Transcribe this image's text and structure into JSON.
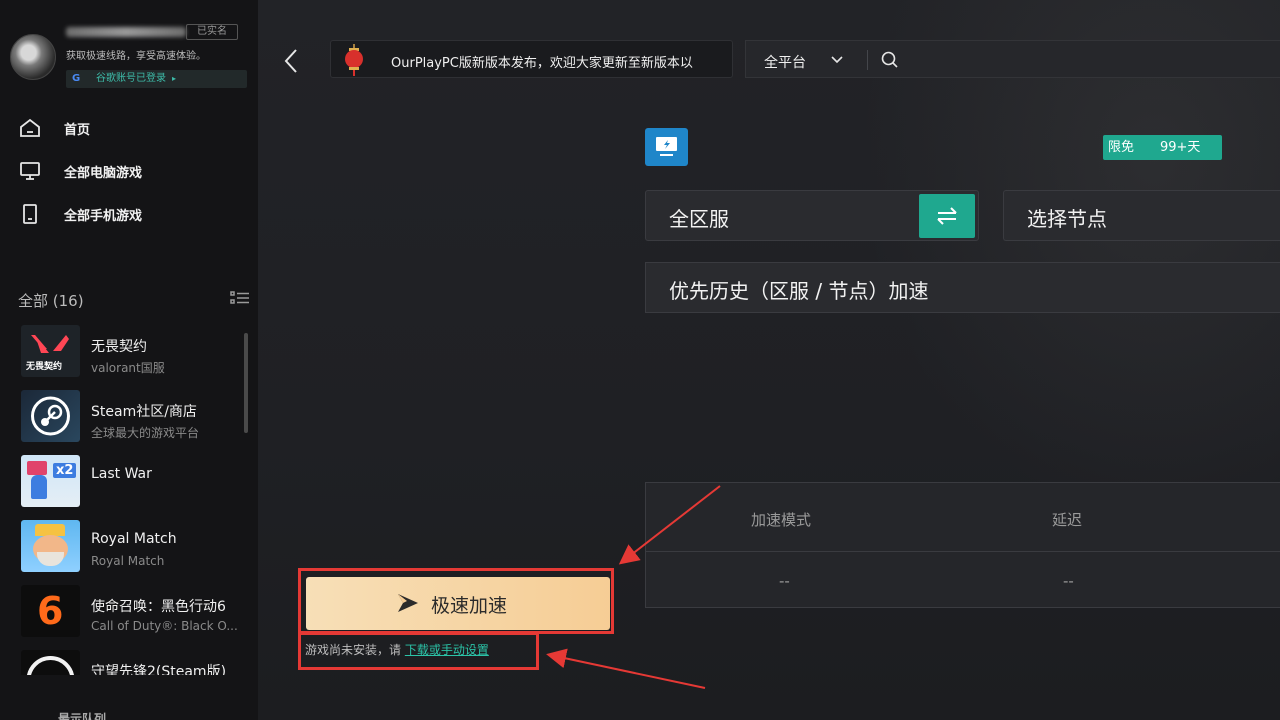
{
  "sidebar": {
    "realname_badge": "已实名",
    "slogan": "获取极速线路，享受高速体验。",
    "google_label": "谷歌账号已登录",
    "google_arrow": "▸",
    "nav": [
      {
        "label": "首页",
        "icon": "home-icon"
      },
      {
        "label": "全部电脑游戏",
        "icon": "desktop-icon"
      },
      {
        "label": "全部手机游戏",
        "icon": "mobile-icon"
      }
    ],
    "all_count": "全部 (16)",
    "games": [
      {
        "title": "无畏契约",
        "subtitle": "valorant国服",
        "thumb_text": "无畏契约"
      },
      {
        "title": "Steam社区/商店",
        "subtitle": "全球最大的游戏平台"
      },
      {
        "title": "Last War",
        "subtitle": "",
        "thumb_text": "x2"
      },
      {
        "title": "Royal Match",
        "subtitle": "Royal Match"
      },
      {
        "title": "使命召唤：黑色行动6",
        "subtitle": "Call of Duty®: Black O...",
        "thumb_text": "6"
      },
      {
        "title": "守望先锋2(Steam版)",
        "subtitle": ""
      }
    ],
    "bottom_label": "最示队列"
  },
  "header": {
    "announcement": "OurPlayPC版新版本发布，欢迎大家更新至新版本以",
    "platform": "全平台"
  },
  "main": {
    "free_label": "限免",
    "free_days": "99+天",
    "region": "全区服",
    "node": "选择节点",
    "priority": "优先历史（区服 / 节点）加速",
    "stats": {
      "mode_header": "加速模式",
      "latency_header": "延迟",
      "mode_value": "--",
      "latency_value": "--"
    },
    "boost_label": "极速加速",
    "install_note": "游戏尚未安装，请 ",
    "install_link": "下载或手动设置"
  },
  "colors": {
    "accent": "#1fa88f",
    "highlight_red": "#e53935",
    "boost_gradient_start": "#f7dfb7",
    "boost_gradient_end": "#f6cd95"
  }
}
